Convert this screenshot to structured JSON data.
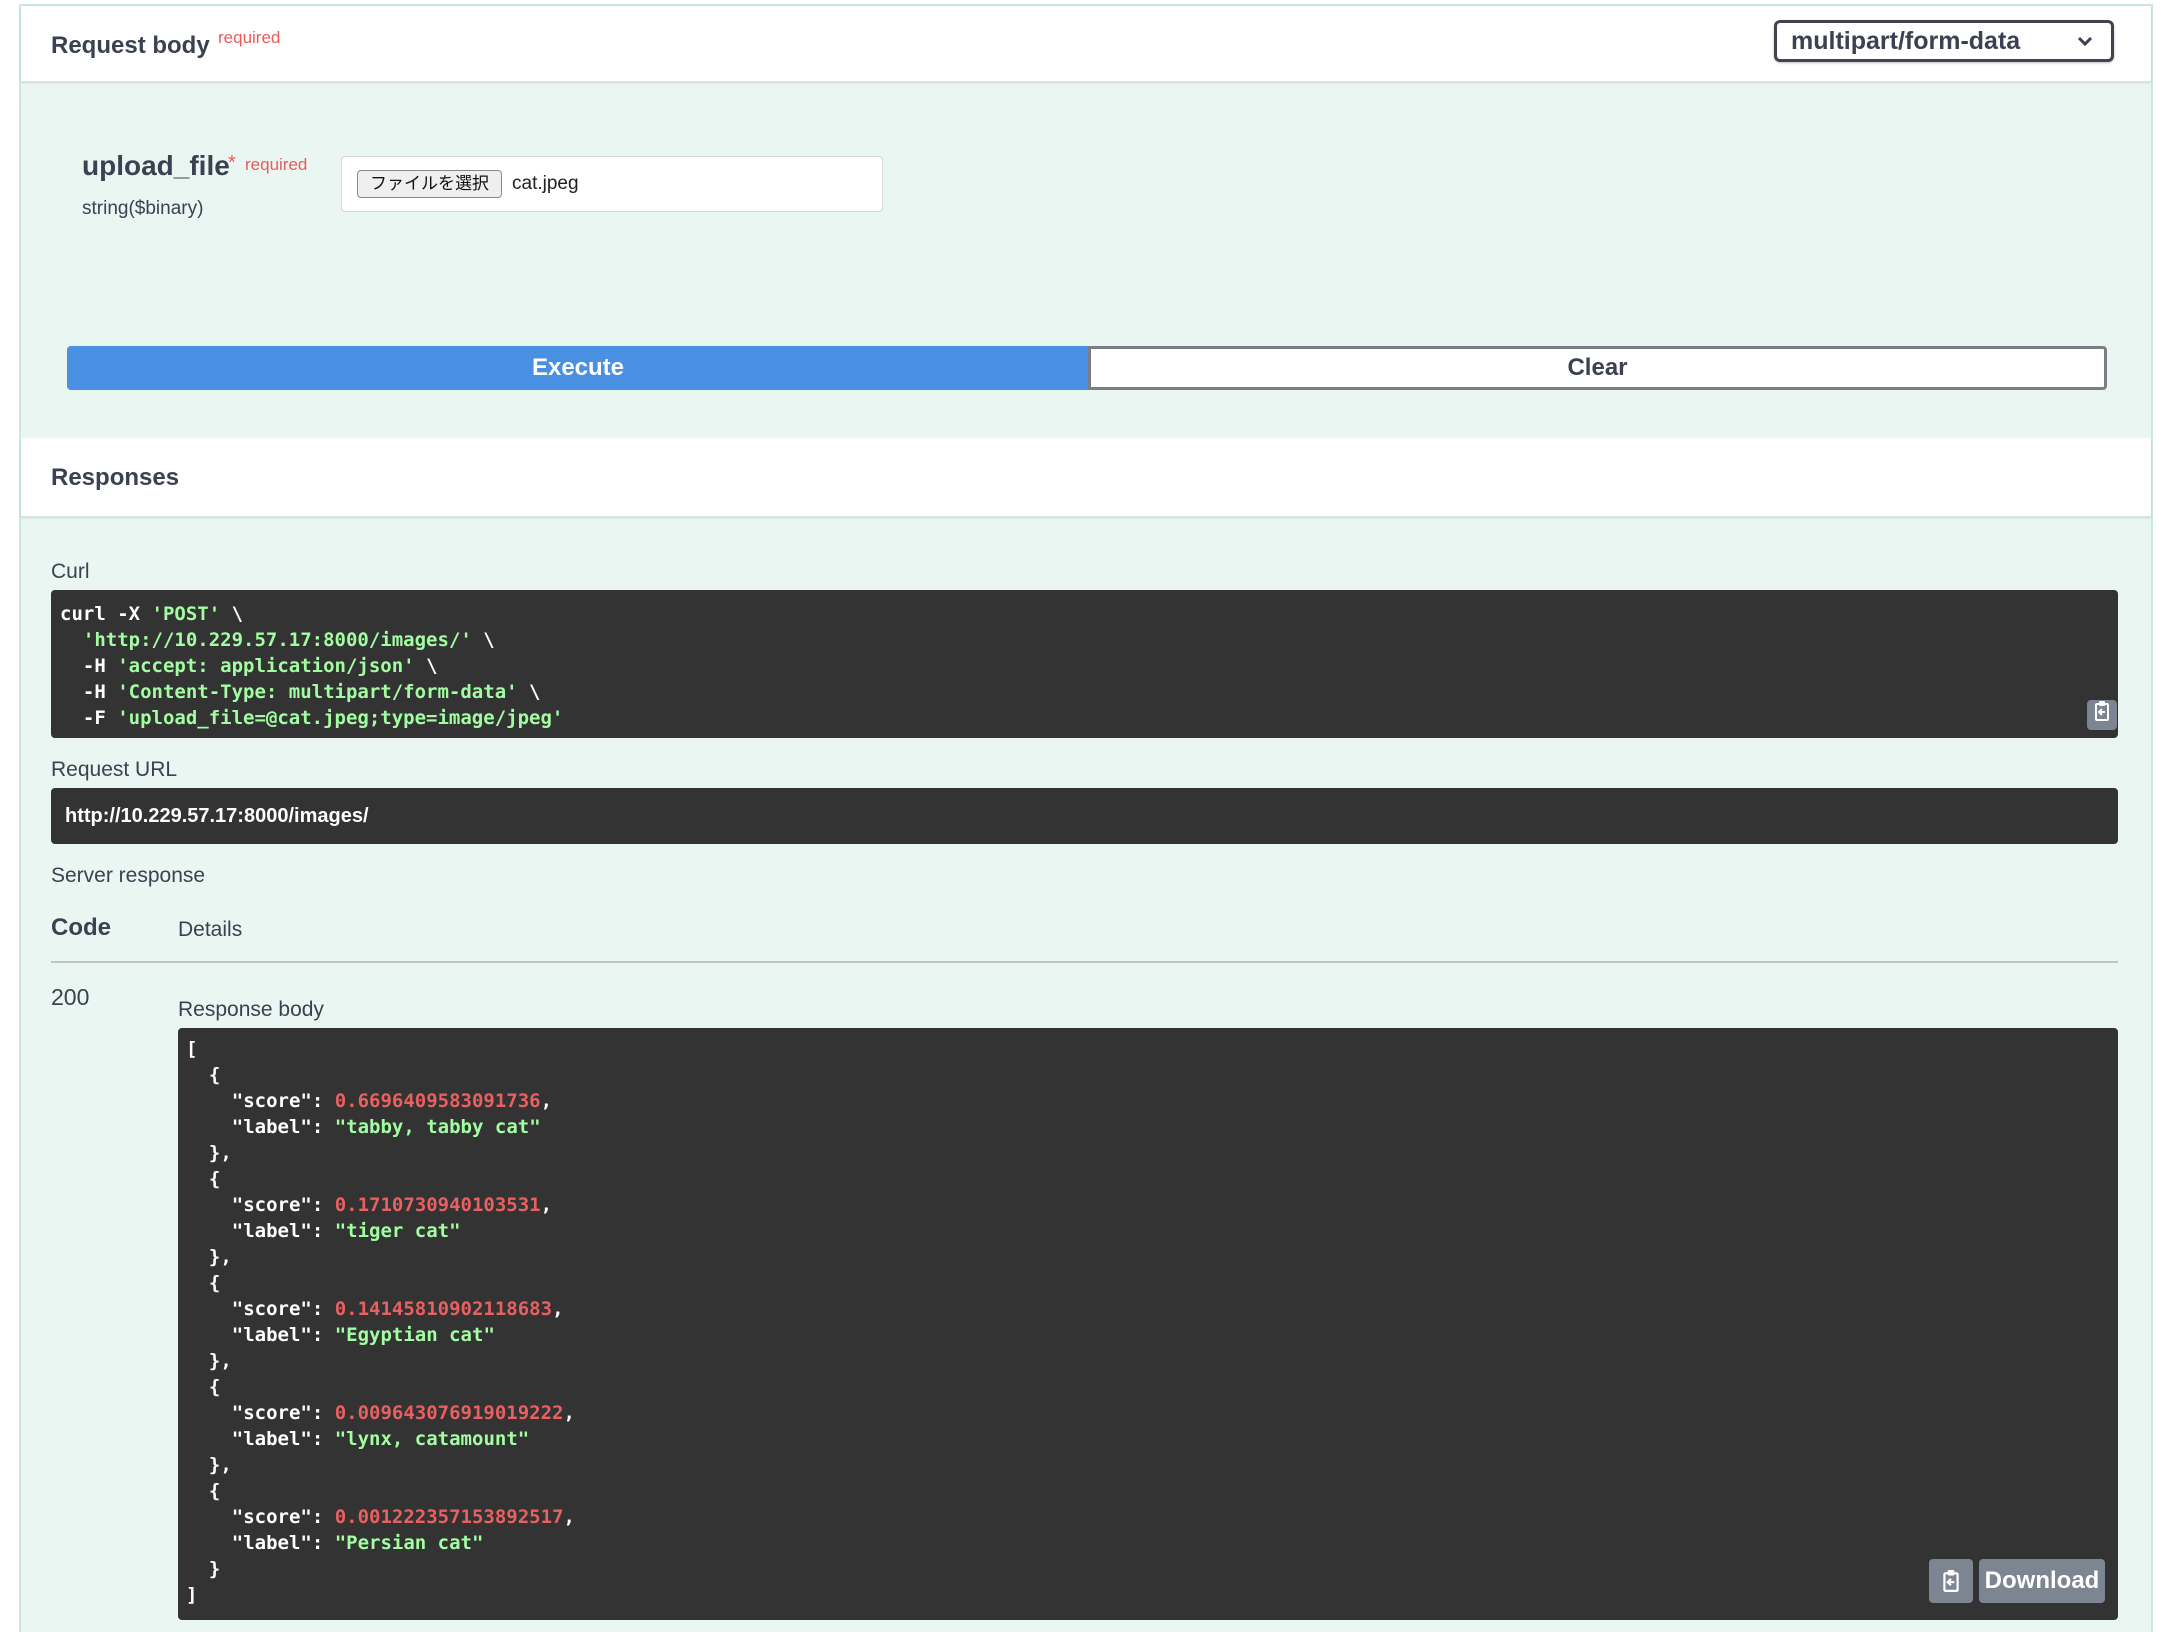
{
  "request_body": {
    "title": "Request body",
    "required_label": "required",
    "content_type": "multipart/form-data"
  },
  "param": {
    "name": "upload_file",
    "star": "*",
    "required_label": "required",
    "type": "string($binary)",
    "file_button_label": "ファイルを選択",
    "file_name": "cat.jpeg"
  },
  "actions": {
    "execute_label": "Execute",
    "clear_label": "Clear"
  },
  "responses": {
    "title": "Responses",
    "curl_label": "Curl",
    "curl_lines": [
      {
        "pre": "curl -X ",
        "str": "'POST'",
        "post": " \\"
      },
      {
        "pre": "  ",
        "str": "'http://10.229.57.17:8000/images/'",
        "post": " \\"
      },
      {
        "pre": "  -H ",
        "str": "'accept: application/json'",
        "post": " \\"
      },
      {
        "pre": "  -H ",
        "str": "'Content-Type: multipart/form-data'",
        "post": " \\"
      },
      {
        "pre": "  -F ",
        "str": "'upload_file=@cat.jpeg;type=image/jpeg'",
        "post": ""
      }
    ],
    "request_url_label": "Request URL",
    "request_url": "http://10.229.57.17:8000/images/",
    "server_response_label": "Server response",
    "code_header": "Code",
    "details_header": "Details",
    "status_code": "200",
    "response_body_label": "Response body",
    "results": [
      {
        "score": "0.6696409583091736",
        "label": "tabby, tabby cat"
      },
      {
        "score": "0.1710730940103531",
        "label": "tiger cat"
      },
      {
        "score": "0.14145810902118683",
        "label": "Egyptian cat"
      },
      {
        "score": "0.009643076919019222",
        "label": "lynx, catamount"
      },
      {
        "score": "0.001222357153892517",
        "label": "Persian cat"
      }
    ],
    "download_label": "Download"
  },
  "icons": {
    "copy": "copy-to-clipboard-icon",
    "dropdown": "chevron-down-icon"
  },
  "colors": {
    "execute": "#4990e2",
    "code_bg": "#333333",
    "string": "#a2fca2",
    "number": "#e86060",
    "required": "#e85c5c"
  }
}
